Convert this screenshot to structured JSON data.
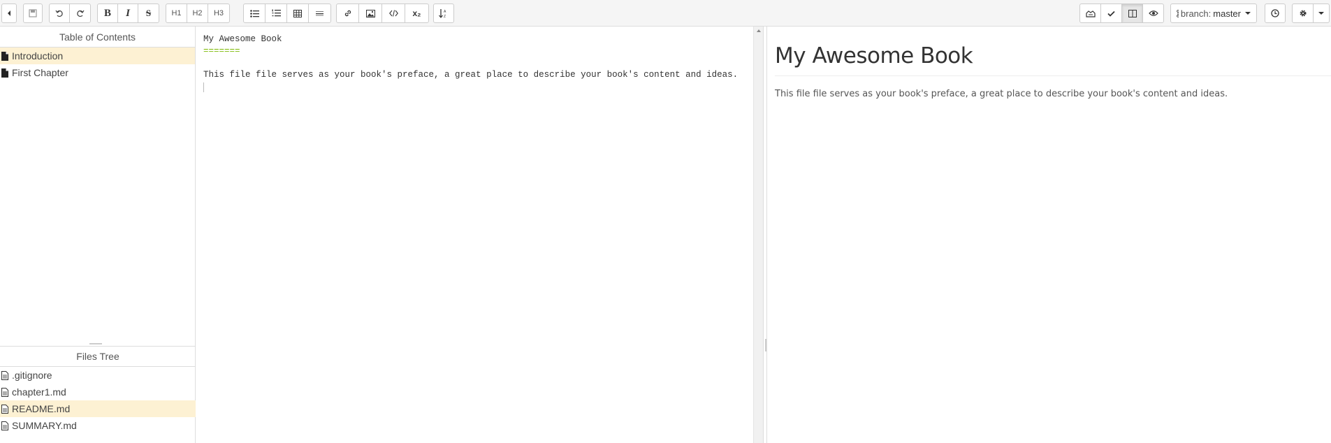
{
  "toolbar": {
    "buttons": {
      "back": "back-icon",
      "save": "save-icon",
      "undo": "undo-icon",
      "redo": "redo-icon",
      "bold": "B",
      "italic": "I",
      "strike": "S",
      "h1": "H1",
      "h2": "H2",
      "h3": "H3",
      "ul": "unordered-list-icon",
      "ol": "ordered-list-icon",
      "table": "table-icon",
      "hr": "horizontal-rule-icon",
      "link": "link-icon",
      "image": "image-icon",
      "code": "code-icon",
      "subscript": "x₂",
      "sort": "sort-icon"
    },
    "branch_prefix": "branch:",
    "branch_name": "master"
  },
  "toc": {
    "title": "Table of Contents",
    "items": [
      {
        "label": "Introduction",
        "active": true
      },
      {
        "label": "First Chapter",
        "active": false
      }
    ]
  },
  "files": {
    "title": "Files Tree",
    "items": [
      {
        "label": ".gitignore",
        "active": false
      },
      {
        "label": "chapter1.md",
        "active": false
      },
      {
        "label": "README.md",
        "active": true
      },
      {
        "label": "SUMMARY.md",
        "active": false
      }
    ]
  },
  "editor": {
    "line1": "My Awesome Book",
    "line2": "=======",
    "line3": "",
    "line4": "This file file serves as your book's preface, a great place to describe your book's content and ideas."
  },
  "preview": {
    "heading": "My Awesome Book",
    "paragraph": "This file file serves as your book's preface, a great place to describe your book's content and ideas."
  },
  "colors": {
    "active_row": "#fdf1d3",
    "setext_underline": "#7ab800"
  }
}
